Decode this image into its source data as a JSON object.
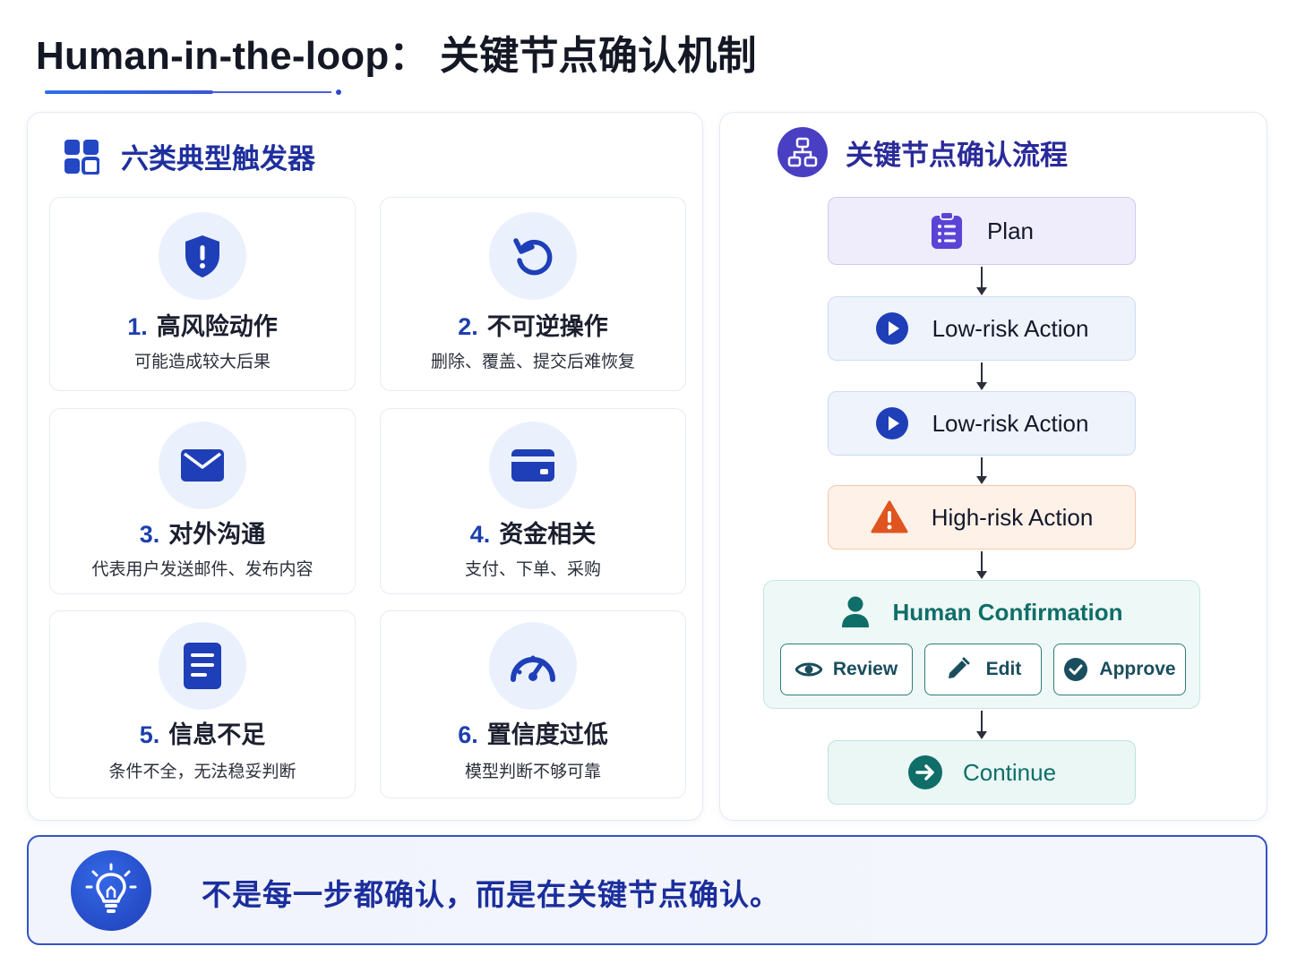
{
  "page": {
    "title": "Human-in-the-loop： 关键节点确认机制"
  },
  "triggers": {
    "heading": "六类典型触发器",
    "icon": "grid-icon",
    "items": [
      {
        "number": "1.",
        "title": "高风险动作",
        "desc": "可能造成较大后果",
        "icon": "shield-alert-icon"
      },
      {
        "number": "2.",
        "title": "不可逆操作",
        "desc": "删除、覆盖、提交后难恢复",
        "icon": "undo-icon"
      },
      {
        "number": "3.",
        "title": "对外沟通",
        "desc": "代表用户发送邮件、发布内容",
        "icon": "mail-icon"
      },
      {
        "number": "4.",
        "title": "资金相关",
        "desc": "支付、下单、采购",
        "icon": "credit-card-icon"
      },
      {
        "number": "5.",
        "title": "信息不足",
        "desc": "条件不全，无法稳妥判断",
        "icon": "document-icon"
      },
      {
        "number": "6.",
        "title": "置信度过低",
        "desc": "模型判断不够可靠",
        "icon": "gauge-icon"
      }
    ]
  },
  "flow": {
    "heading": "关键节点确认流程",
    "icon": "hierarchy-icon",
    "plan": "Plan",
    "low_risk_1": "Low-risk Action",
    "low_risk_2": "Low-risk Action",
    "high_risk": "High-risk Action",
    "human": {
      "title": "Human Confirmation",
      "review": "Review",
      "edit": "Edit",
      "approve": "Approve"
    },
    "continue": "Continue"
  },
  "banner": {
    "message": "不是每一步都确认，而是在关键节点确认。",
    "icon": "lightbulb-icon"
  },
  "colors": {
    "primary": "#1d3fae",
    "teal": "#0f6e68",
    "warning": "#e0551f",
    "purple": "#4a3fc2"
  }
}
